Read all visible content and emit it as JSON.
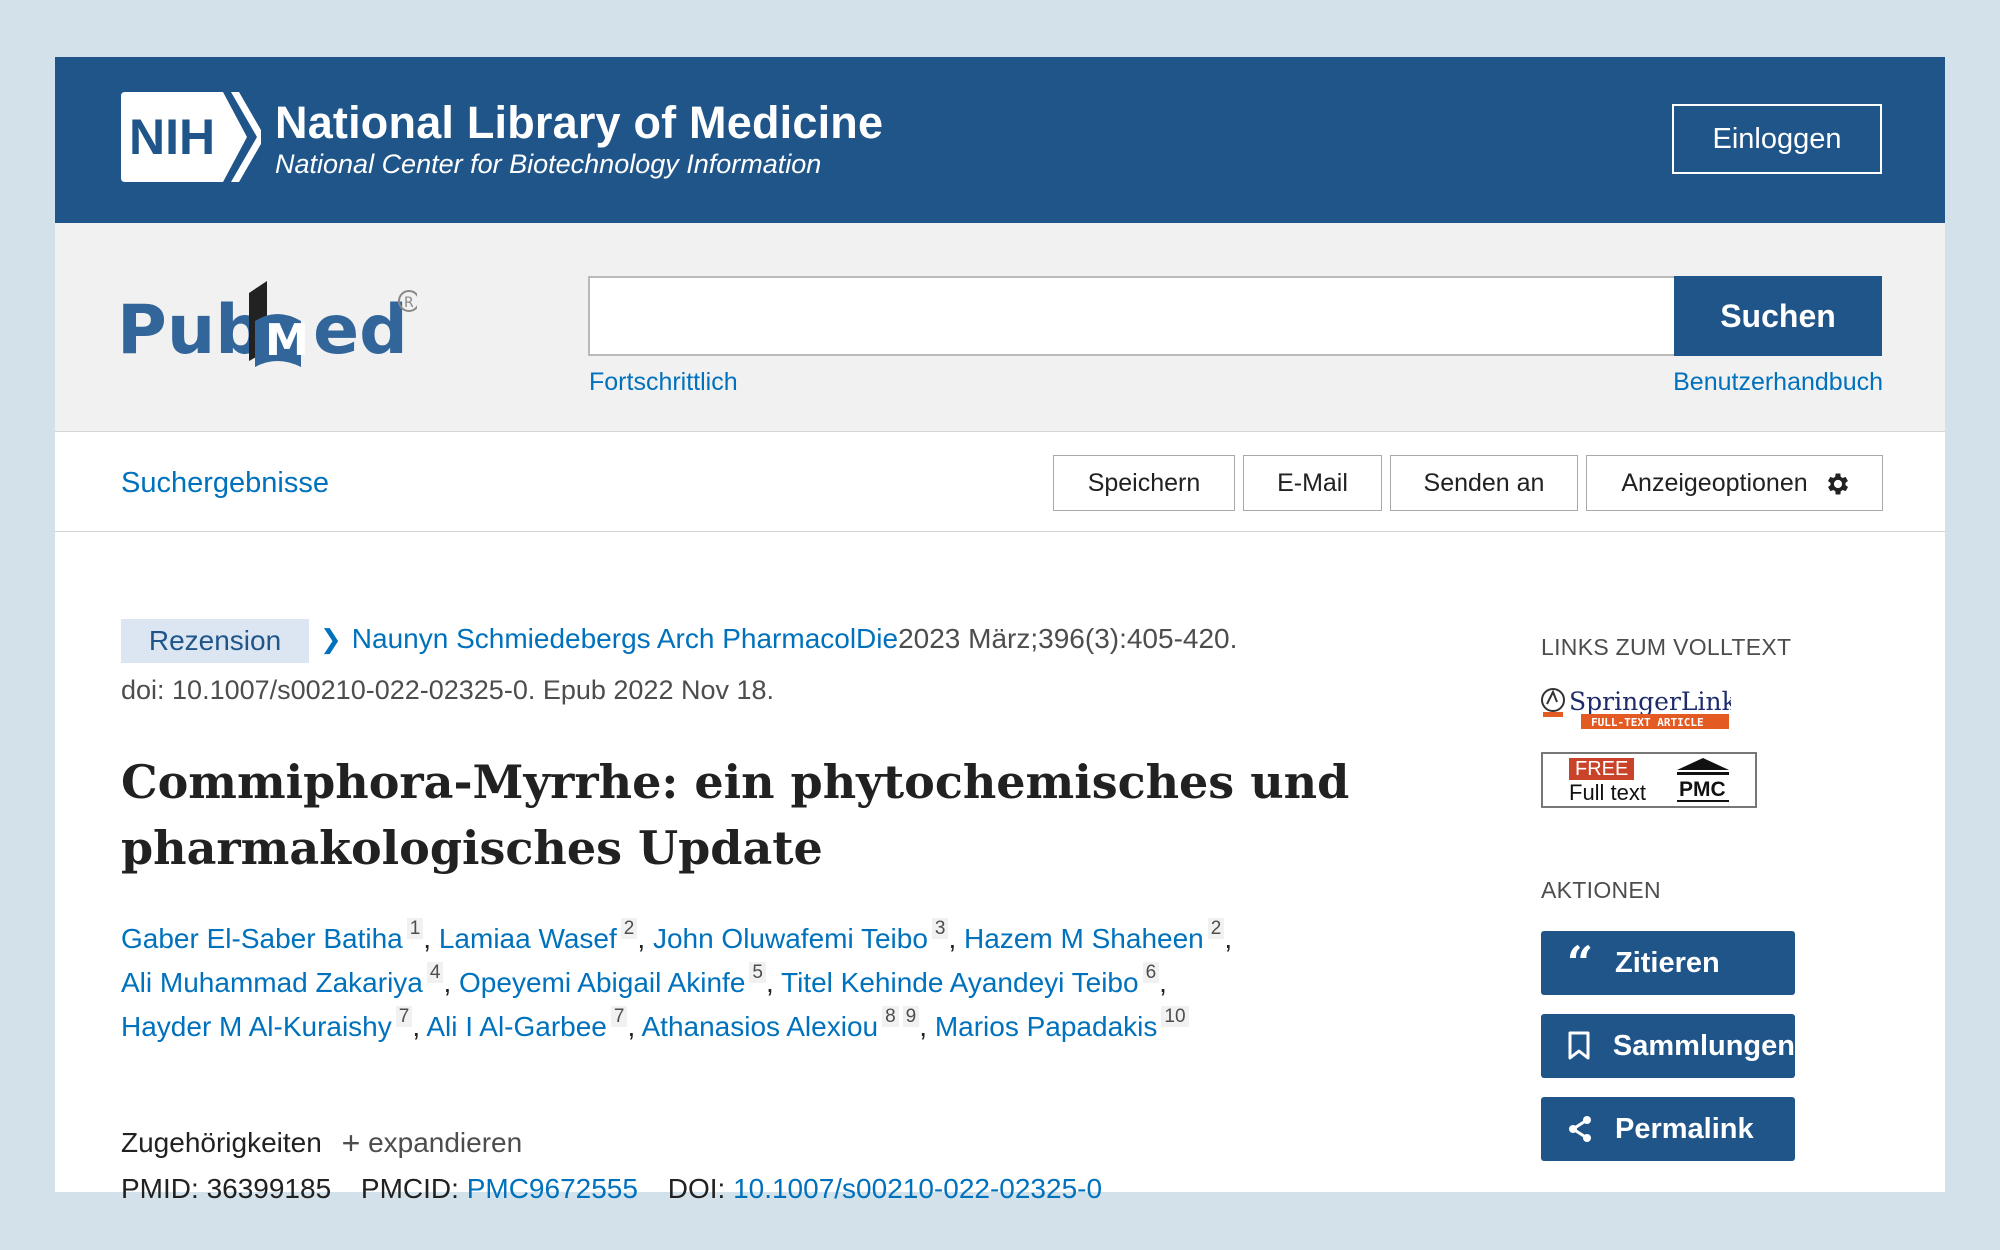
{
  "header": {
    "logo_text": "NIH",
    "title": "National Library of Medicine",
    "subtitle": "National Center for Biotechnology Information",
    "login_label": "Einloggen"
  },
  "search": {
    "logo_text": "PubMed",
    "placeholder": "",
    "value": "",
    "button_label": "Suchen",
    "advanced_link": "Fortschrittlich",
    "manual_link": "Benutzerhandbuch"
  },
  "toolbar": {
    "back_label": "Suchergebnisse",
    "buttons": [
      "Speichern",
      "E-Mail",
      "Senden an",
      "Anzeigeoptionen"
    ]
  },
  "article": {
    "type_badge": "Rezension",
    "journal": "Naunyn Schmiedebergs Arch PharmacolDie",
    "citation": "2023 März;396(3):405-420.",
    "doi_line": "doi: 10.1007/s00210-022-02325-0. Epub 2022 Nov 18.",
    "title": "Commiphora-Myrrhe: ein phytochemisches und pharmakologisches Update",
    "authors": [
      {
        "name": "Gaber El-Saber Batiha",
        "aff": [
          "1"
        ]
      },
      {
        "name": "Lamiaa Wasef",
        "aff": [
          "2"
        ]
      },
      {
        "name": "John Oluwafemi Teibo",
        "aff": [
          "3"
        ]
      },
      {
        "name": "Hazem M Shaheen",
        "aff": [
          "2"
        ]
      },
      {
        "name": "Ali Muhammad Zakariya",
        "aff": [
          "4"
        ]
      },
      {
        "name": "Opeyemi Abigail Akinfe",
        "aff": [
          "5"
        ]
      },
      {
        "name": "Titel Kehinde Ayandeyi Teibo",
        "aff": [
          "6"
        ]
      },
      {
        "name": "Hayder M Al-Kuraishy",
        "aff": [
          "7"
        ]
      },
      {
        "name": "Ali I Al-Garbee",
        "aff": [
          "7"
        ]
      },
      {
        "name": "Athanasios Alexiou",
        "aff": [
          "8",
          "9"
        ]
      },
      {
        "name": "Marios Papadakis",
        "aff": [
          "10"
        ]
      }
    ],
    "affiliations_label": "Zugehörigkeiten",
    "expand_label": "expandieren",
    "pmid_label": "PMID:",
    "pmid": "36399185",
    "pmcid_label": "PMCID:",
    "pmcid": "PMC9672555",
    "doi_label": "DOI:",
    "doi": "10.1007/s00210-022-02325-0"
  },
  "sidebar": {
    "fulltext_heading": "LINKS ZUM VOLLTEXT",
    "springer_text": "SpringerLink",
    "springer_sub": "FULL-TEXT ARTICLE",
    "pmc_free": "FREE",
    "pmc_full": "Full text",
    "pmc_logo": "PMC",
    "actions_heading": "AKTIONEN",
    "actions": [
      "Zitieren",
      "Sammlungen",
      "Permalink"
    ]
  },
  "colors": {
    "brand_blue": "#20558a",
    "link_blue": "#0071bc",
    "background": "#d3e2ea"
  }
}
